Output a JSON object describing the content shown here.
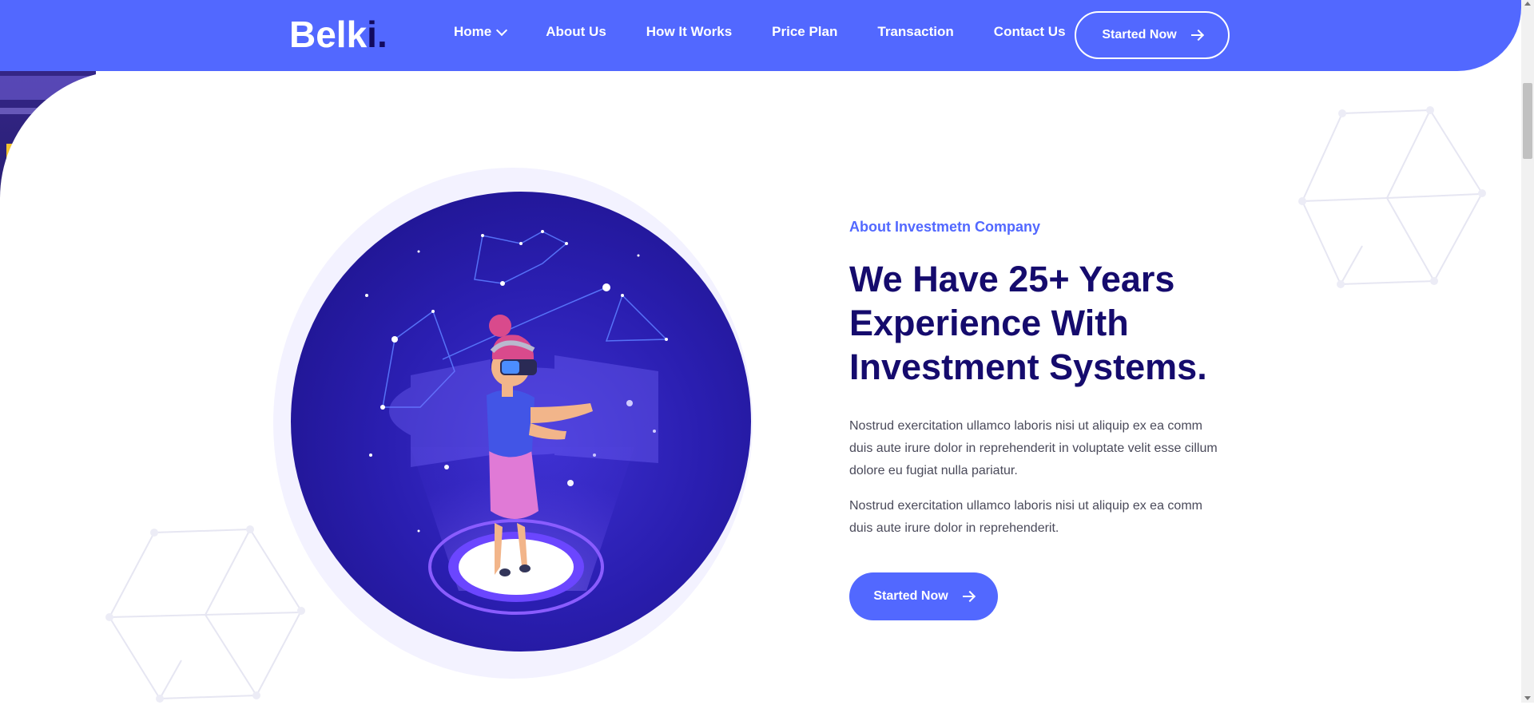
{
  "brand": {
    "logo_main": "Belk",
    "logo_accent": "i.",
    "accent_color": "#5268ff",
    "dark_color": "#150b6d"
  },
  "nav": {
    "items": [
      {
        "label": "Home",
        "has_dropdown": true
      },
      {
        "label": "About Us"
      },
      {
        "label": "How It Works"
      },
      {
        "label": "Price Plan"
      },
      {
        "label": "Transaction"
      },
      {
        "label": "Contact Us"
      }
    ],
    "cta_label": "Started Now"
  },
  "about": {
    "eyebrow": "About Investmetn Company",
    "heading": "We Have 25+ Years Experience With Investment Systems.",
    "paragraph_1": "Nostrud exercitation ullamco laboris nisi ut aliquip ex ea comm duis aute irure dolor in reprehenderit in voluptate velit esse cillum dolore eu fugiat nulla pariatur.",
    "paragraph_2": "Nostrud exercitation ullamco laboris nisi ut aliquip ex ea comm duis aute irure dolor in reprehenderit.",
    "cta_label": "Started Now"
  },
  "icons": {
    "arrow": "arrow-right-icon",
    "chevron": "chevron-down-icon"
  }
}
